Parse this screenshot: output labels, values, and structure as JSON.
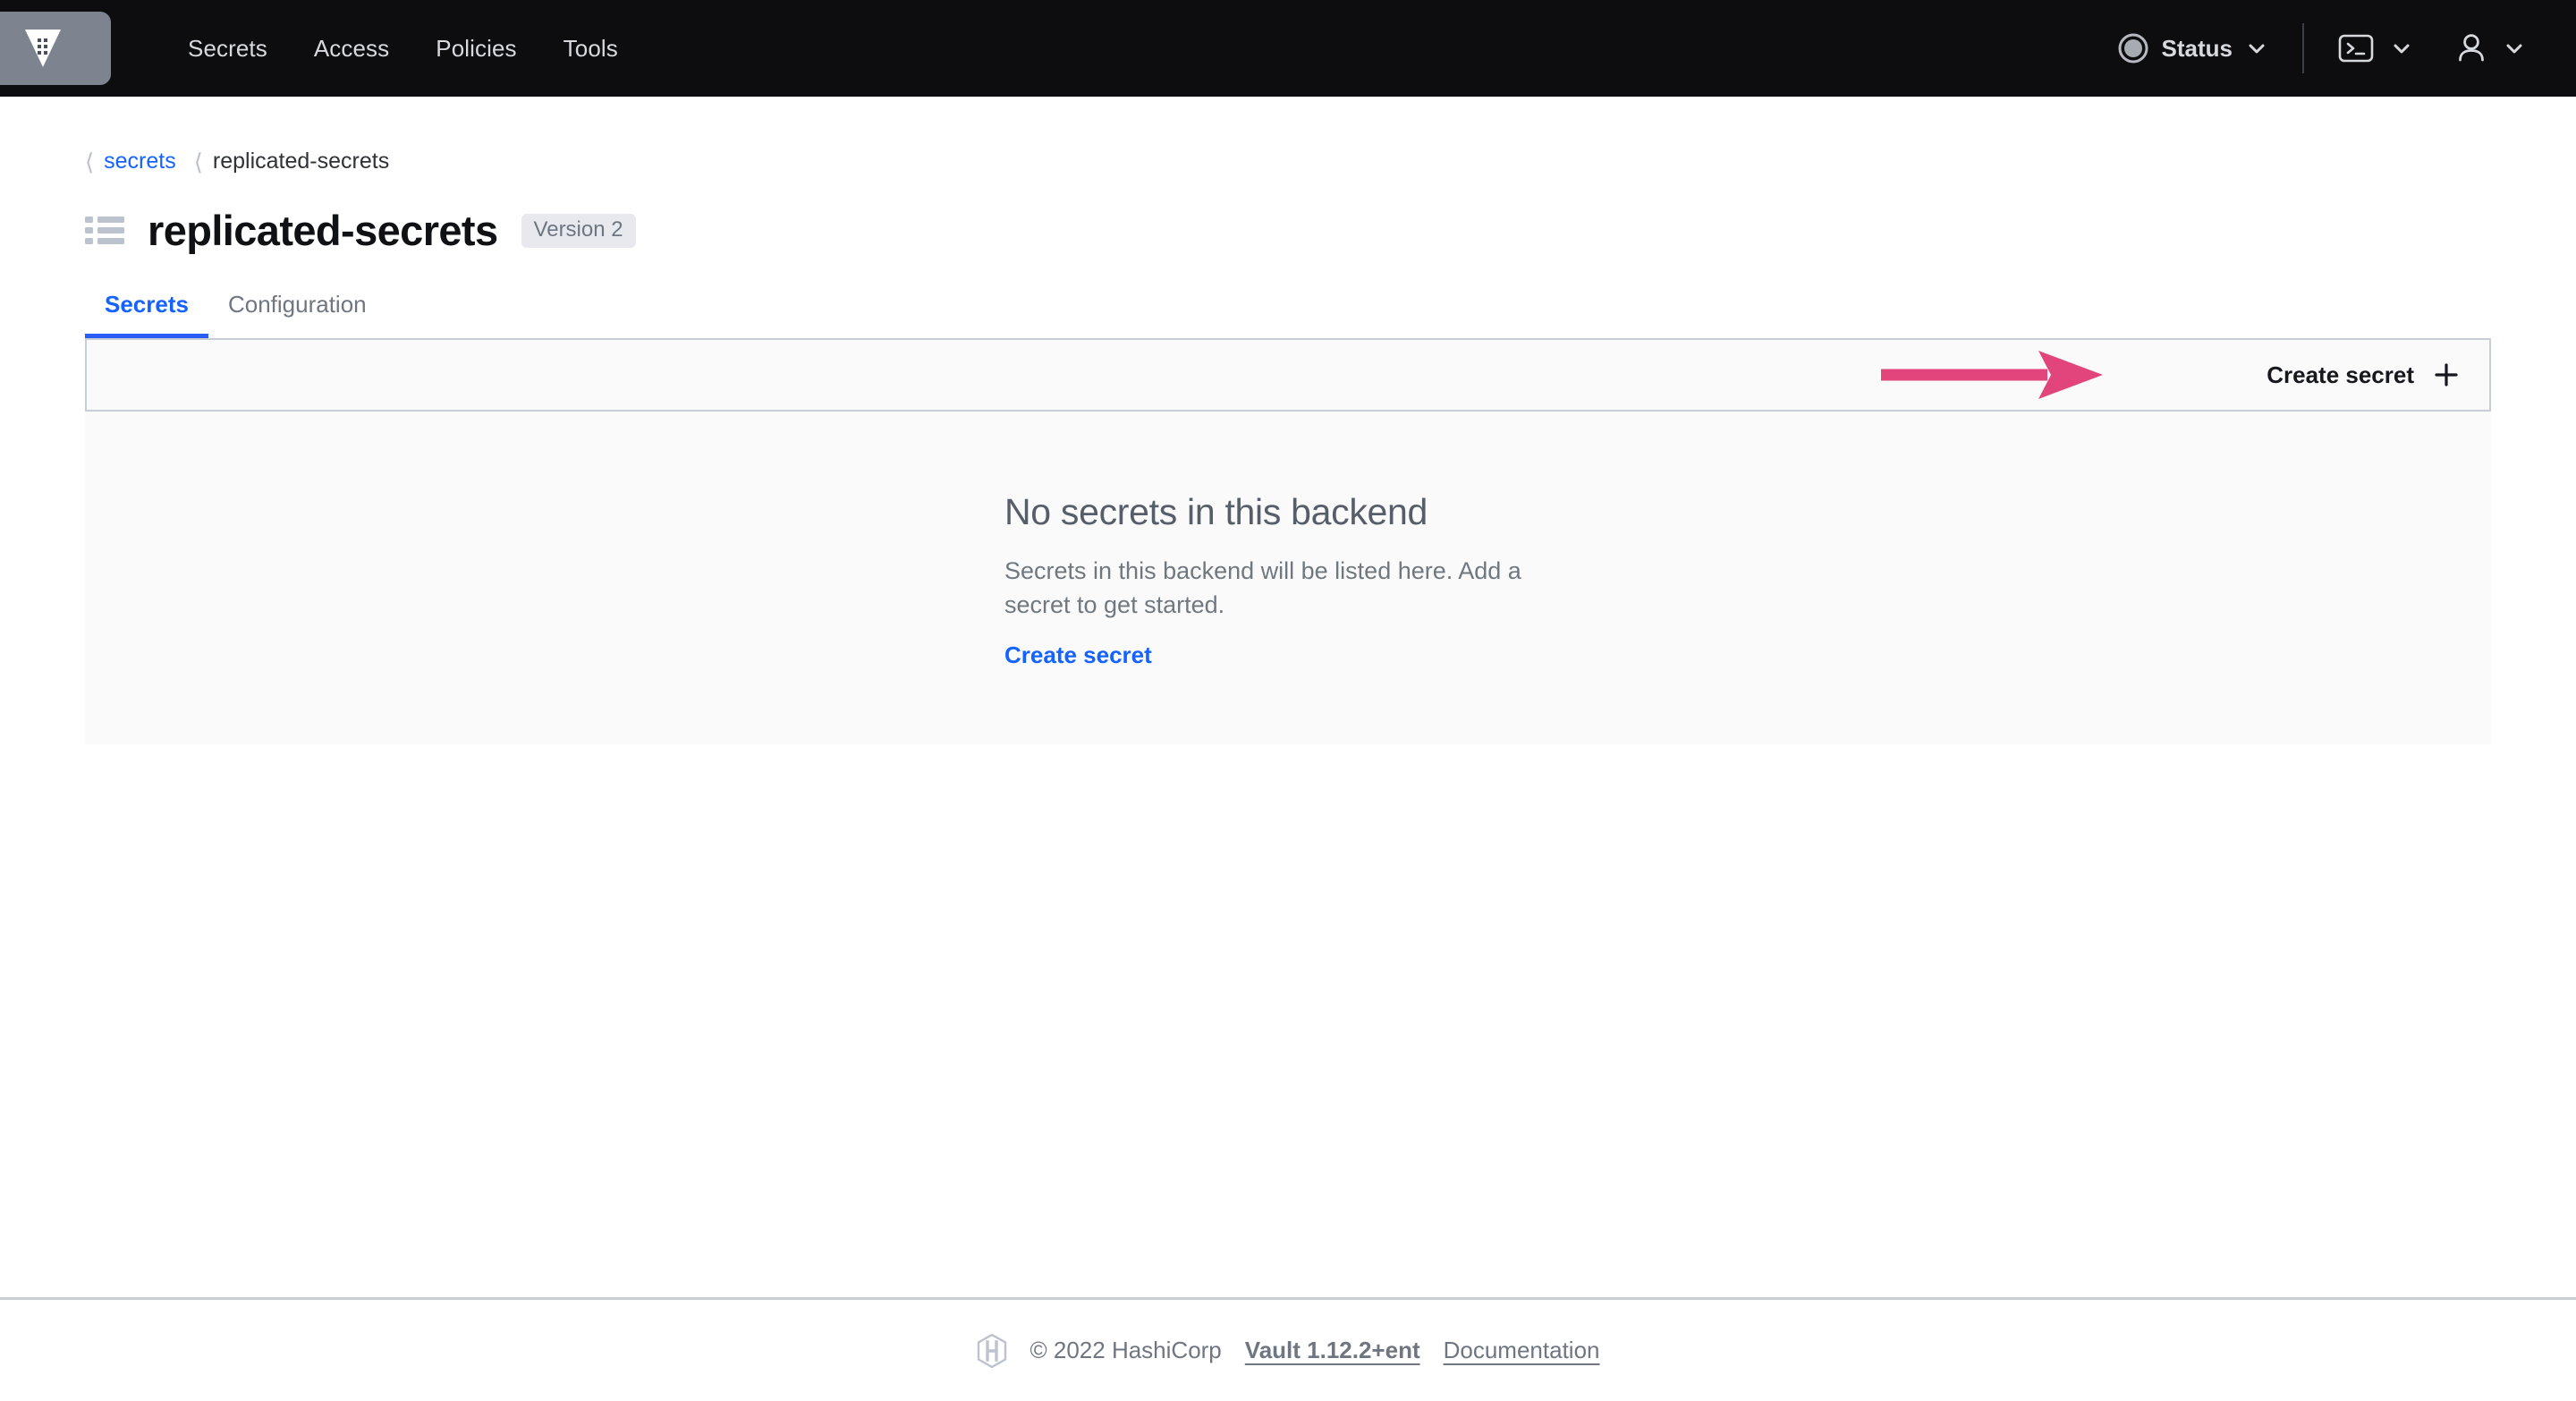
{
  "navbar": {
    "logo_icon": "vault-logo-icon",
    "links": [
      {
        "label": "Secrets"
      },
      {
        "label": "Access"
      },
      {
        "label": "Policies"
      },
      {
        "label": "Tools"
      }
    ],
    "status": {
      "label": "Status",
      "indicator_icon": "status-circle-icon",
      "chevron_icon": "chevron-down-icon"
    },
    "console": {
      "icon": "terminal-console-icon",
      "chevron_icon": "chevron-down-icon"
    },
    "user": {
      "icon": "user-person-icon",
      "chevron_icon": "chevron-down-icon"
    },
    "background_color": "#0d0d0f",
    "logo_box_color": "#7d8490"
  },
  "breadcrumb": {
    "chevron_icon": "chevron-left-icon",
    "items": [
      {
        "label": "secrets",
        "is_link": true
      },
      {
        "label": "replicated-secrets",
        "is_link": false
      }
    ]
  },
  "header": {
    "icon": "list-icon",
    "title": "replicated-secrets",
    "badge": "Version 2"
  },
  "tabs": [
    {
      "label": "Secrets",
      "active": true
    },
    {
      "label": "Configuration",
      "active": false
    }
  ],
  "toolbar": {
    "create_secret_label": "Create secret",
    "plus_icon": "plus-icon",
    "annotation_arrow_color": "#e2457c"
  },
  "empty_state": {
    "title": "No secrets in this backend",
    "body": "Secrets in this backend will be listed here. Add a secret to get started.",
    "link_label": "Create secret"
  },
  "footer": {
    "logo_icon": "hashicorp-logo-icon",
    "copyright": "© 2022 HashiCorp",
    "version_link": "Vault 1.12.2+ent",
    "documentation_link": "Documentation"
  },
  "colors": {
    "accent_blue": "#1563ff",
    "tab_underline": "#2a5cf6",
    "annotation_pink": "#e2457c",
    "panel_bg": "#fafafa",
    "border_grey": "#c9cdd6",
    "muted_text": "#6f7682"
  }
}
